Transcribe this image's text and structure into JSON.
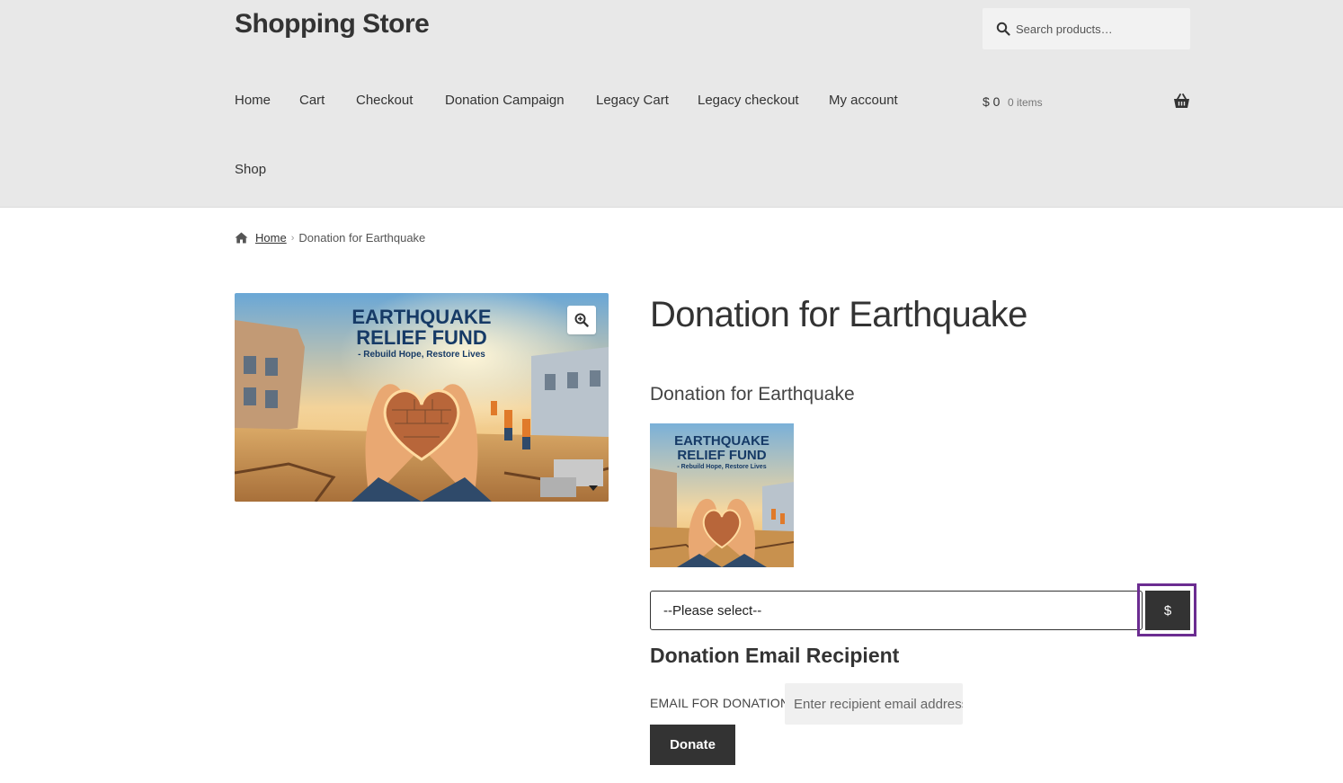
{
  "site": {
    "title": "Shopping Store"
  },
  "search": {
    "placeholder": "Search products…"
  },
  "nav": {
    "items": [
      {
        "label": "Home"
      },
      {
        "label": "Cart"
      },
      {
        "label": "Checkout"
      },
      {
        "label": "Donation Campaign"
      },
      {
        "label": "Legacy Cart"
      },
      {
        "label": "Legacy checkout"
      },
      {
        "label": "My account"
      },
      {
        "label": "Shop"
      }
    ]
  },
  "cart": {
    "amount": "$ 0",
    "count": "0 items"
  },
  "breadcrumb": {
    "home": "Home",
    "current": "Donation for Earthquake"
  },
  "product": {
    "title": "Donation for Earthquake",
    "subtitle": "Donation for Earthquake",
    "image_text": {
      "line1": "EARTHQUAKE",
      "line2": "RELIEF FUND",
      "line3": "- Rebuild Hope, Restore Lives"
    }
  },
  "donation": {
    "select_value": "--Please select--",
    "currency_symbol": "$",
    "section_title": "Donation Email Recipient",
    "email_label": "EMAIL FOR DONATION",
    "email_placeholder": "Enter recipient email address",
    "donate_label": "Donate"
  },
  "colors": {
    "header_bg": "#e8e8e8",
    "button_dark": "#333333",
    "focus_outline": "#6b2c91"
  }
}
